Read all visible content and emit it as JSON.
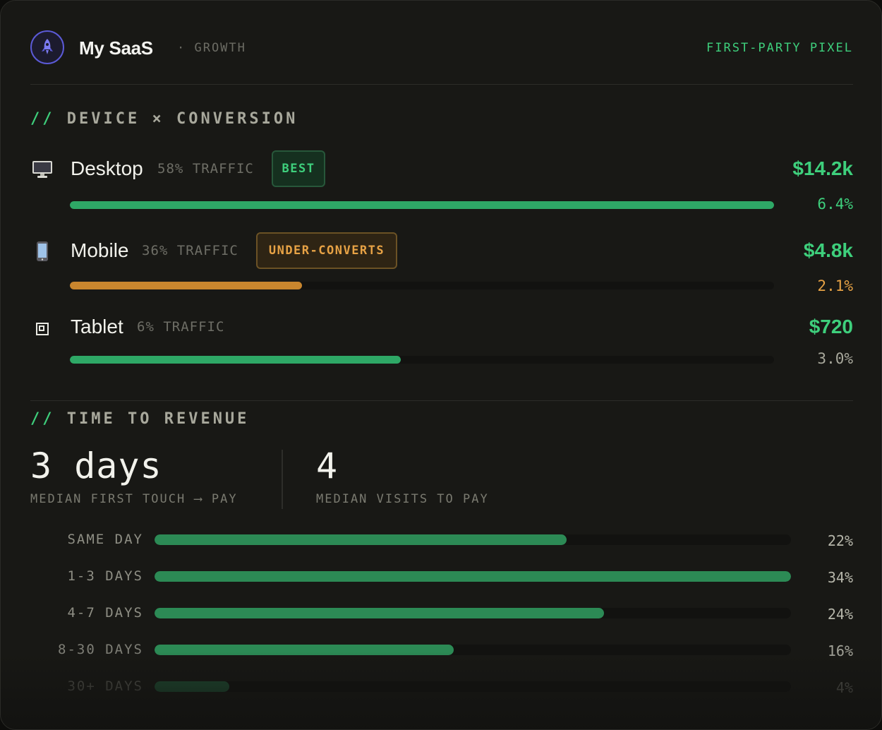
{
  "header": {
    "app_name": "My SaaS",
    "subtitle": "· GROWTH",
    "badge": "FIRST-PARTY PIXEL",
    "logo_icon": "rocket-icon"
  },
  "device_section": {
    "title_prefix": "//",
    "title": "DEVICE × CONVERSION",
    "rows": [
      {
        "icon": "desktop-icon",
        "name": "Desktop",
        "traffic": "58% TRAFFIC",
        "badge": "BEST",
        "revenue": "$14.2k",
        "rate": "6.4%",
        "bar_fraction": 1.0,
        "color": "#2ea866",
        "rate_color": "#3ecf7c"
      },
      {
        "icon": "mobile-icon",
        "name": "Mobile",
        "traffic": "36% TRAFFIC",
        "badge": "UNDER-CONVERTS",
        "revenue": "$4.8k",
        "rate": "2.1%",
        "bar_fraction": 0.33,
        "color": "#c9862e",
        "rate_color": "#e7a245"
      },
      {
        "icon": "tablet-icon",
        "name": "Tablet",
        "traffic": "6% TRAFFIC",
        "badge": "",
        "revenue": "$720",
        "rate": "3.0%",
        "bar_fraction": 0.47,
        "color": "#2ea866",
        "rate_color": "#a8a89c"
      }
    ]
  },
  "time_section": {
    "title_prefix": "//",
    "title": "TIME TO REVENUE",
    "median_days": "3 days",
    "median_days_label": "MEDIAN FIRST TOUCH ⟶ PAY",
    "median_visits": "4",
    "median_visits_label": "MEDIAN VISITS TO PAY"
  },
  "chart_data": {
    "type": "bar",
    "categories": [
      "SAME DAY",
      "1-3 DAYS",
      "4-7 DAYS",
      "8-30 DAYS",
      "30+ DAYS"
    ],
    "values": [
      22,
      34,
      24,
      16,
      4
    ],
    "value_labels": [
      "22%",
      "34%",
      "24%",
      "16%",
      "4%"
    ],
    "xlim": [
      0,
      34
    ],
    "orientation": "horizontal",
    "bar_color": "#2c8a55"
  }
}
